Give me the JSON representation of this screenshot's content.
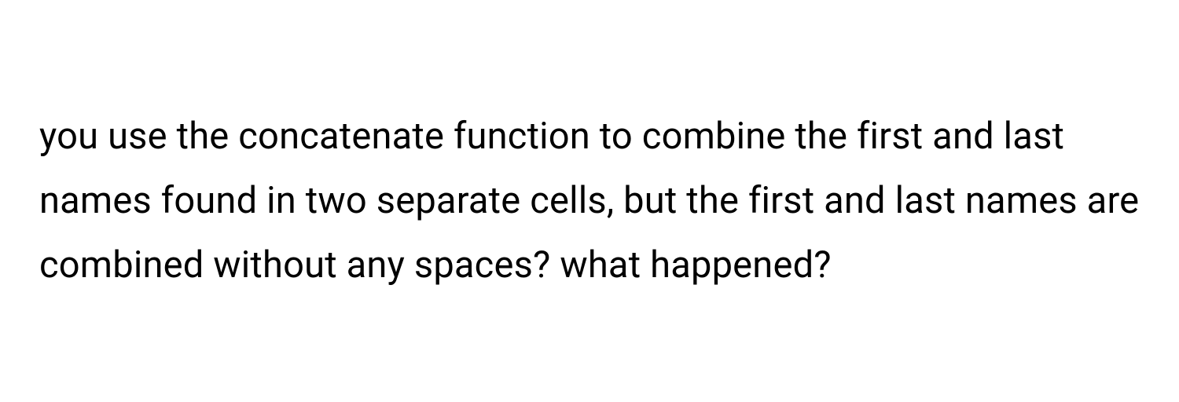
{
  "document": {
    "paragraph": "you use the concatenate function to combine the first and last names found in two separate cells, but the first and last names are combined without any spaces? what happened?"
  }
}
